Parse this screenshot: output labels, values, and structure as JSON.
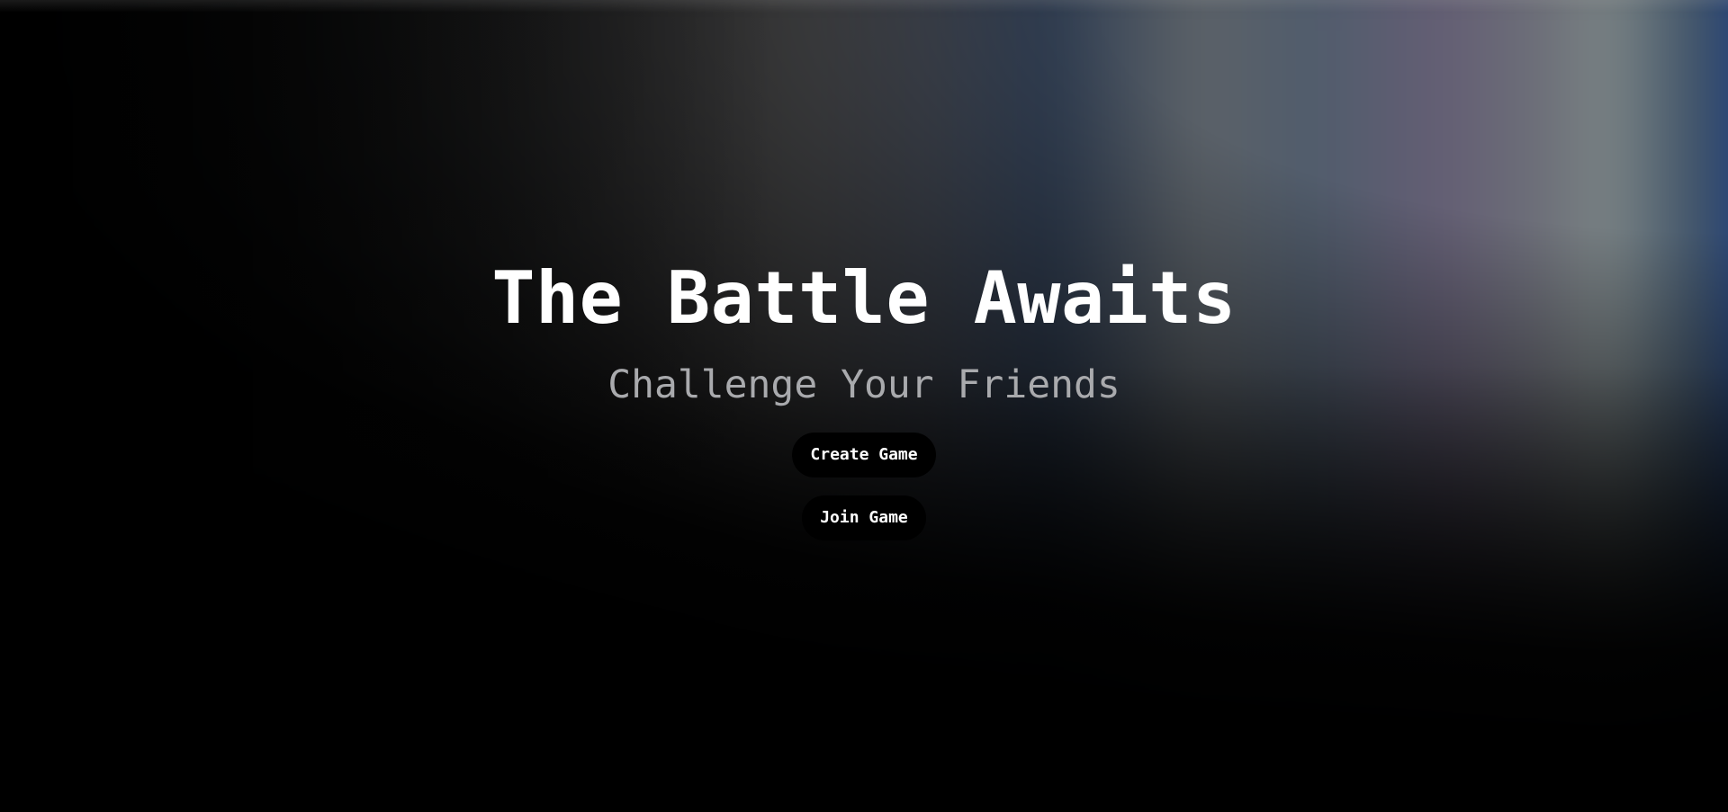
{
  "hero": {
    "title": "The Battle Awaits",
    "subtitle": "Challenge Your Friends"
  },
  "actions": {
    "create_label": "Create Game",
    "join_label": "Join Game"
  },
  "colors": {
    "background": "#000000",
    "title": "#ffffff",
    "subtitle": "#a9aaad",
    "button_bg": "#000000",
    "button_text": "#ffffff"
  }
}
